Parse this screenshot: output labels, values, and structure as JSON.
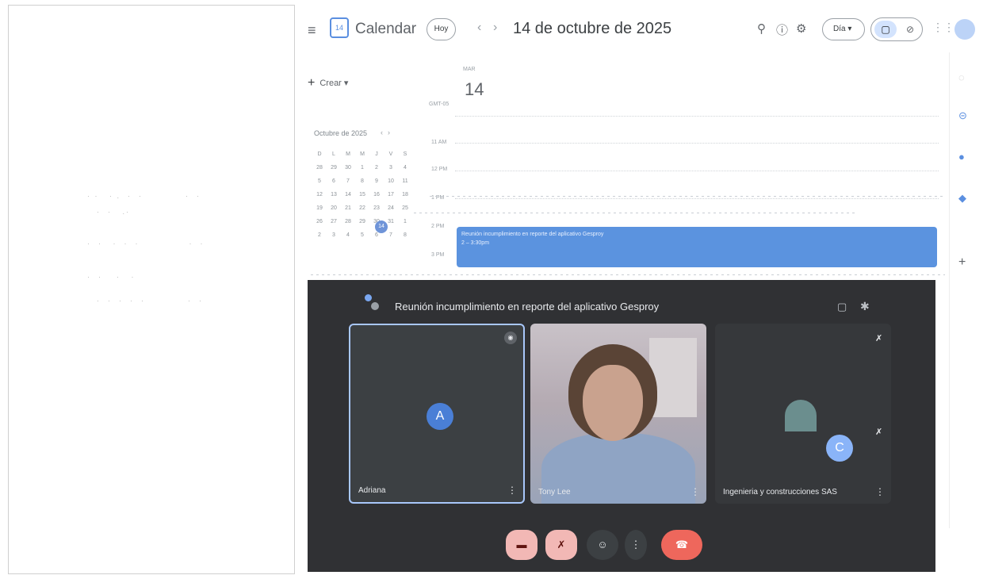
{
  "calendar": {
    "app_title": "Calendar",
    "today_label": "Hoy",
    "date_title": "14 de octubre de 2025",
    "view_label": "Día",
    "create_label": "Crear",
    "mini_month_title": "Octubre de 2025",
    "day_label": "MAR",
    "day_number": "14",
    "timezone_label": "GMT-05",
    "time_labels": [
      "11 AM",
      "12 PM",
      "1 PM",
      "2 PM",
      "3 PM"
    ],
    "mini_days": [
      [
        "D",
        "L",
        "M",
        "M",
        "J",
        "V",
        "S"
      ],
      [
        "28",
        "29",
        "30",
        "1",
        "2",
        "3",
        "4"
      ],
      [
        "5",
        "6",
        "7",
        "8",
        "9",
        "10",
        "11"
      ],
      [
        "12",
        "13",
        "14",
        "15",
        "16",
        "17",
        "18"
      ],
      [
        "19",
        "20",
        "21",
        "22",
        "23",
        "24",
        "25"
      ],
      [
        "26",
        "27",
        "28",
        "29",
        "30",
        "31",
        "1"
      ],
      [
        "2",
        "3",
        "4",
        "5",
        "6",
        "7",
        "8"
      ]
    ],
    "event": {
      "title": "Reunión incumplimiento en reporte del aplicativo Gesproy",
      "time": "2 – 3:30pm"
    }
  },
  "meet": {
    "title": "Reunión incumplimiento en reporte del aplicativo Gesproy",
    "participants": [
      {
        "name": "Adriana",
        "initial": "A"
      },
      {
        "name": "Tony Lee",
        "initial": ""
      },
      {
        "name": "Ingenieria y construcciones SAS",
        "initial": "C"
      }
    ]
  },
  "colors": {
    "accent": "#5b93df",
    "meet_bg": "#303134",
    "end_call": "#ee675c"
  }
}
